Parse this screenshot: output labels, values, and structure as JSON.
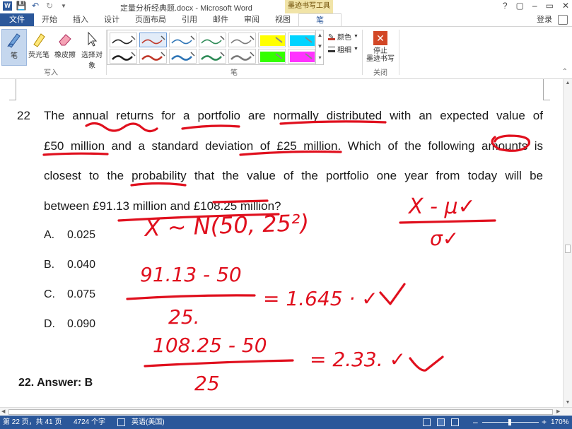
{
  "window": {
    "title": "定量分析经典题.docx - Microsoft Word",
    "context_tab_group": "墨迹书写工具",
    "controls": [
      "?",
      "▢",
      "–",
      "▭",
      "✕"
    ]
  },
  "quick_access": [
    "word-logo-icon",
    "save-icon",
    "undo-icon",
    "redo-icon",
    "customize-icon"
  ],
  "quick_access_word_letter": "W",
  "tabs": [
    "文件",
    "开始",
    "插入",
    "设计",
    "页面布局",
    "引用",
    "邮件",
    "审阅",
    "视图",
    "笔"
  ],
  "login": "登录",
  "ribbon": {
    "write_tools": [
      {
        "label": "笔",
        "icon": "pen-icon",
        "active": true
      },
      {
        "label": "荧光笔",
        "icon": "highlighter-icon",
        "active": false
      },
      {
        "label": "橡皮擦",
        "icon": "eraser-icon",
        "active": false
      },
      {
        "label": "选择对象",
        "icon": "select-cursor-icon",
        "active": false
      }
    ],
    "write_group_label": "写入",
    "pen_group_label": "笔",
    "color_label": "颜色",
    "thickness_label": "粗细",
    "stop_label_1": "停止",
    "stop_label_2": "墨迹书写",
    "close_group_label": "关闭",
    "pen_swatches": [
      {
        "color": "#222222",
        "style": "pen"
      },
      {
        "color": "#c0392b",
        "style": "pen"
      },
      {
        "color": "#2e75b6",
        "style": "pen"
      },
      {
        "color": "#2e8b57",
        "style": "pen"
      },
      {
        "color": "#7a7a7a",
        "style": "pen"
      },
      {
        "color": "#ffff00",
        "style": "highlighter"
      },
      {
        "color": "#00d4ff",
        "style": "highlighter"
      },
      {
        "color": "#222222",
        "style": "pen"
      },
      {
        "color": "#c0392b",
        "style": "pen"
      },
      {
        "color": "#2e75b6",
        "style": "pen"
      },
      {
        "color": "#2e8b57",
        "style": "pen"
      },
      {
        "color": "#7a7a7a",
        "style": "pen"
      },
      {
        "color": "#33ff00",
        "style": "highlighter"
      },
      {
        "color": "#ff33ff",
        "style": "highlighter"
      }
    ]
  },
  "document": {
    "question_number": "22",
    "question_lines": [
      "The annual returns for a portfolio are normally distributed with an expected value of",
      "£50 million and a standard deviation of £25 million. Which of the following amounts is",
      "closest to the probability that the value of the portfolio one year from today will be",
      "between £91.13 million and £108.25 million?"
    ],
    "options": [
      {
        "letter": "A.",
        "value": "0.025"
      },
      {
        "letter": "B.",
        "value": "0.040"
      },
      {
        "letter": "C.",
        "value": "0.075"
      },
      {
        "letter": "D.",
        "value": "0.090"
      }
    ],
    "answer": "22.  Answer: B",
    "ink": {
      "formula_top": "X - μ✓",
      "formula_bottom": "σ✓",
      "distribution": "X ~ N(50, 25²)",
      "calc1_num": "91.13 - 50",
      "calc1_den": "25.",
      "calc1_result": "= 1.645 · ✓",
      "calc2_num": "108.25 - 50",
      "calc2_den": "25",
      "calc2_result": "= 2.33. ✓",
      "color": "#e0101e"
    }
  },
  "status": {
    "page": "第 22 页，共 41 页",
    "words": "4724 个字",
    "language": "英语(美国)",
    "zoom": "170%",
    "zoom_out": "–",
    "zoom_in": "+"
  }
}
